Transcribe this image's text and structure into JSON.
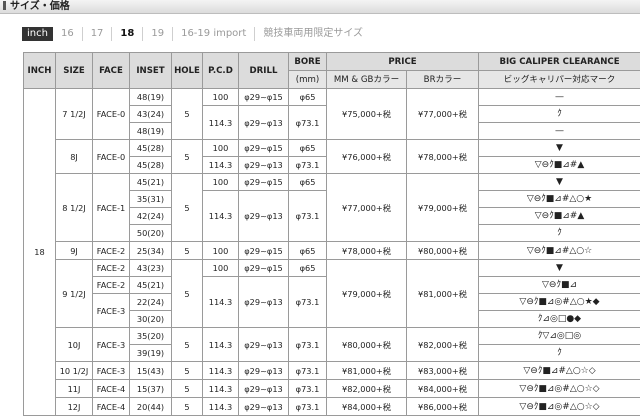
{
  "header": {
    "title": "サイズ・価格"
  },
  "tabs": [
    {
      "label": "inch"
    },
    {
      "label": "16"
    },
    {
      "label": "17"
    },
    {
      "label": "18"
    },
    {
      "label": "19"
    },
    {
      "label": "16-19 import"
    },
    {
      "label": "競技車両用限定サイズ"
    }
  ],
  "table": {
    "headers": {
      "inch": "INCH",
      "size": "SIZE",
      "face": "FACE",
      "inset": "INSET",
      "hole": "HOLE",
      "pcd": "P.C.D",
      "drill": "DRILL",
      "bore": "BORE",
      "bore_unit": "(mm)",
      "price": "PRICE",
      "price_mm": "MM & GBカラー",
      "price_br": "BRカラー",
      "caliper": "BIG CALIPER CLEARANCE",
      "caliper_sub": "ビッグキャリパー対応マーク"
    },
    "inch_value": "18",
    "r1": {
      "size": "7 1/2J",
      "face": "FACE-0",
      "hole": "5",
      "inset": [
        "48(19)",
        "43(24)",
        "48(19)"
      ],
      "pcd": [
        "100",
        "114.3"
      ],
      "drill": [
        "φ29~φ15",
        "φ29~φ13"
      ],
      "bore": [
        "φ65",
        "φ73.1"
      ],
      "price_mm": "¥75,000+税",
      "price_br": "¥77,000+税",
      "mark": [
        "—",
        "ｸ",
        "—"
      ]
    },
    "r2": {
      "size": "8J",
      "face": "FACE-0",
      "hole": "5",
      "inset": [
        "45(28)",
        "45(28)"
      ],
      "pcd": [
        "100",
        "114.3"
      ],
      "drill": [
        "φ29~φ15",
        "φ29~φ13"
      ],
      "bore": [
        "φ65",
        "φ73.1"
      ],
      "price_mm": "¥76,000+税",
      "price_br": "¥78,000+税",
      "mark": [
        "▼",
        "▽⊖ｸ■⊿#▲"
      ]
    },
    "r3": {
      "size": "8 1/2J",
      "face": "FACE-1",
      "hole": "5",
      "inset": [
        "45(21)",
        "35(31)",
        "42(24)",
        "50(20)"
      ],
      "pcd": [
        "100",
        "114.3"
      ],
      "drill": [
        "φ29~φ15",
        "φ29~φ13"
      ],
      "bore": [
        "φ65",
        "φ73.1"
      ],
      "price_mm": "¥77,000+税",
      "price_br": "¥79,000+税",
      "mark": [
        "▼",
        "▽⊖ｸ■⊿#△○★",
        "▽⊖ｸ■⊿#▲",
        "ｸ"
      ]
    },
    "r4": {
      "size": "9J",
      "face": "FACE-2",
      "inset": "25(34)",
      "hole": "5",
      "pcd": "100",
      "drill": "φ29~φ15",
      "bore": "φ65",
      "price_mm": "¥78,000+税",
      "price_br": "¥80,000+税",
      "mark": "▽⊖ｸ■⊿#△○☆"
    },
    "r5": {
      "size": "9 1/2J",
      "faces": [
        "FACE-2",
        "FACE-2",
        "FACE-3"
      ],
      "hole": "5",
      "inset": [
        "43(23)",
        "45(21)",
        "22(24)",
        "30(20)"
      ],
      "pcd": [
        "100",
        "114.3"
      ],
      "drill": [
        "φ29~φ15",
        "φ29~φ13"
      ],
      "bore": [
        "φ65",
        "φ73.1"
      ],
      "price_mm": "¥79,000+税",
      "price_br": "¥81,000+税",
      "mark": [
        "▼",
        "▽⊖ｸ■⊿",
        "▽⊖ｸ■⊿◎#△○★◆",
        "ｸ⊿◎□●◆"
      ]
    },
    "r6": {
      "size": "10J",
      "face": "FACE-3",
      "hole": "5",
      "inset": [
        "35(20)",
        "39(19)"
      ],
      "pcd": "114.3",
      "drill": "φ29~φ13",
      "bore": "φ73.1",
      "price_mm": "¥80,000+税",
      "price_br": "¥82,000+税",
      "mark": [
        "ｸ▽⊿◎□◎",
        "ｸ"
      ]
    },
    "r7": {
      "size": "10 1/2J",
      "face": "FACE-3",
      "inset": "15(43)",
      "hole": "5",
      "pcd": "114.3",
      "drill": "φ29~φ13",
      "bore": "φ73.1",
      "price_mm": "¥81,000+税",
      "price_br": "¥83,000+税",
      "mark": "▽⊖ｸ■⊿#△○☆◇"
    },
    "r8": {
      "size": "11J",
      "face": "FACE-4",
      "inset": "15(37)",
      "hole": "5",
      "pcd": "114.3",
      "drill": "φ29~φ13",
      "bore": "φ73.1",
      "price_mm": "¥82,000+税",
      "price_br": "¥84,000+税",
      "mark": "▽⊖ｸ■⊿◎#△○☆◇"
    },
    "r9": {
      "size": "12J",
      "face": "FACE-4",
      "inset": "20(44)",
      "hole": "5",
      "pcd": "114.3",
      "drill": "φ29~φ13",
      "bore": "φ73.1",
      "price_mm": "¥84,000+税",
      "price_br": "¥86,000+税",
      "mark": "▽⊖ｸ■⊿◎#△○☆◇"
    }
  }
}
